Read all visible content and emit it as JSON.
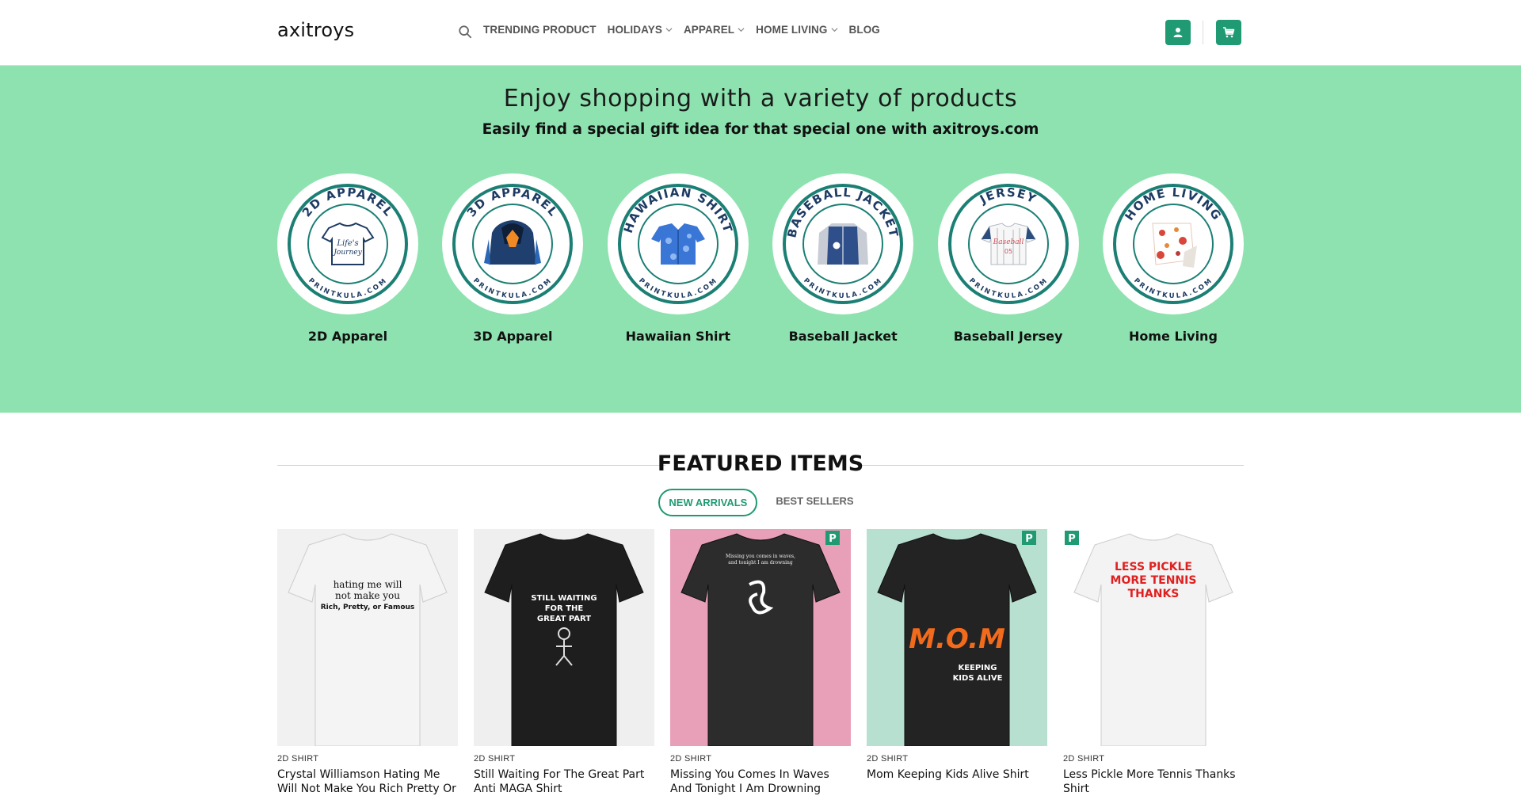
{
  "header": {
    "logo": "axitroys",
    "nav": [
      {
        "label": "TRENDING PRODUCT",
        "dropdown": false
      },
      {
        "label": "HOLIDAYS",
        "dropdown": true
      },
      {
        "label": "APPAREL",
        "dropdown": true
      },
      {
        "label": "HOME LIVING",
        "dropdown": true
      },
      {
        "label": "BLOG",
        "dropdown": false
      }
    ],
    "accent_color": "#1f9a72"
  },
  "hero": {
    "title": "Enjoy shopping with a variety of products",
    "subtitle": "Easily find a special gift idea for that special one with axitroys.com",
    "background": "#8ee2b0",
    "categories": [
      {
        "label": "2D Apparel",
        "ring_text": "2D APPAREL",
        "site": "PRINTKULA.COM",
        "icon": "tshirt-icon"
      },
      {
        "label": "3D Apparel",
        "ring_text": "3D APPAREL",
        "site": "PRINTKULA.COM",
        "icon": "hoodie-icon"
      },
      {
        "label": "Hawaiian Shirt",
        "ring_text": "HAWAIIAN SHIRT",
        "site": "PRINTKULA.COM",
        "icon": "hawaiian-shirt-icon"
      },
      {
        "label": "Baseball Jacket",
        "ring_text": "BASEBALL JACKET",
        "site": "PRINTKULA.COM",
        "icon": "jacket-icon"
      },
      {
        "label": "Baseball Jersey",
        "ring_text": "JERSEY",
        "site": "PRINTKULA.COM",
        "icon": "jersey-icon"
      },
      {
        "label": "Home Living",
        "ring_text": "HOME LIVING",
        "site": "PRINTKULA.COM",
        "icon": "blanket-icon"
      }
    ]
  },
  "featured": {
    "title": "FEATURED ITEMS",
    "tabs": [
      {
        "label": "NEW ARRIVALS",
        "active": true
      },
      {
        "label": "BEST SELLERS",
        "active": false
      }
    ],
    "products": [
      {
        "category": "2D SHIRT",
        "name": "Crystal Williamson Hating Me Will Not Make You Rich Pretty Or",
        "shirt_color": "#f4f4f4",
        "print": "hating me will not make you Rich, Pretty, or Famous",
        "bg": "#f1f1f1"
      },
      {
        "category": "2D SHIRT",
        "name": "Still Waiting For The Great Part Anti MAGA Shirt",
        "shirt_color": "#1e1e1e",
        "print": "STILL WAITING FOR THE GREAT PART",
        "bg": "#efefef"
      },
      {
        "category": "2D SHIRT",
        "name": "Missing You Comes In Waves And Tonight I Am Drowning",
        "shirt_color": "#2c2c2c",
        "print": "Missing you comes in waves, and tonight I am drowning",
        "bg": "#e8a0b8"
      },
      {
        "category": "2D SHIRT",
        "name": "Mom Keeping Kids Alive Shirt",
        "shirt_color": "#232323",
        "print": "M.O.M KEEPING KIDS ALIVE",
        "bg": "#b8e0d0"
      },
      {
        "category": "2D SHIRT",
        "name": "Less Pickle More Tennis Thanks Shirt",
        "shirt_color": "#f3f3f3",
        "print": "LESS PICKLE MORE TENNIS THANKS",
        "bg": "#ffffff"
      }
    ]
  }
}
